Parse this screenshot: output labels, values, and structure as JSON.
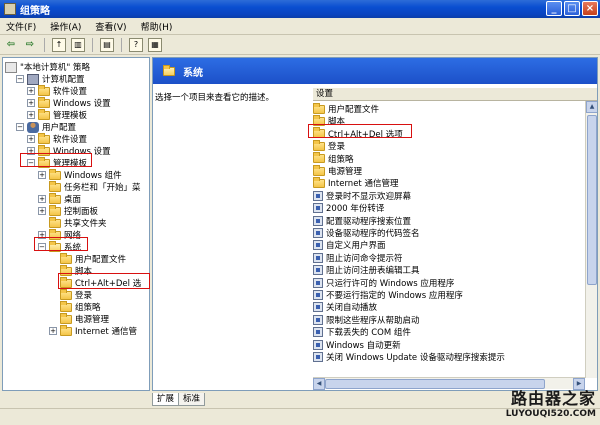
{
  "window": {
    "title": "组策略"
  },
  "menubar": [
    "文件(F)",
    "操作(A)",
    "查看(V)",
    "帮助(H)"
  ],
  "tree": [
    {
      "label": "\"本地计算机\" 策略",
      "indent": 0,
      "exp": "",
      "icon": "policy"
    },
    {
      "label": "计算机配置",
      "indent": 1,
      "exp": "-",
      "icon": "computer"
    },
    {
      "label": "软件设置",
      "indent": 2,
      "exp": "+",
      "icon": "folder"
    },
    {
      "label": "Windows 设置",
      "indent": 2,
      "exp": "+",
      "icon": "folder"
    },
    {
      "label": "管理模板",
      "indent": 2,
      "exp": "+",
      "icon": "folder"
    },
    {
      "label": "用户配置",
      "indent": 1,
      "exp": "-",
      "icon": "user"
    },
    {
      "label": "软件设置",
      "indent": 2,
      "exp": "+",
      "icon": "folder"
    },
    {
      "label": "Windows 设置",
      "indent": 2,
      "exp": "+",
      "icon": "folder"
    },
    {
      "label": "管理模板",
      "indent": 2,
      "exp": "-",
      "icon": "folder"
    },
    {
      "label": "Windows 组件",
      "indent": 3,
      "exp": "+",
      "icon": "folder"
    },
    {
      "label": "任务栏和「开始」菜",
      "indent": 3,
      "exp": "",
      "icon": "folder"
    },
    {
      "label": "桌面",
      "indent": 3,
      "exp": "+",
      "icon": "folder"
    },
    {
      "label": "控制面板",
      "indent": 3,
      "exp": "+",
      "icon": "folder"
    },
    {
      "label": "共享文件夹",
      "indent": 3,
      "exp": "",
      "icon": "folder"
    },
    {
      "label": "网络",
      "indent": 3,
      "exp": "+",
      "icon": "folder"
    },
    {
      "label": "系统",
      "indent": 3,
      "exp": "-",
      "icon": "folder-open"
    },
    {
      "label": "用户配置文件",
      "indent": 4,
      "exp": "",
      "icon": "folder"
    },
    {
      "label": "脚本",
      "indent": 4,
      "exp": "",
      "icon": "folder"
    },
    {
      "label": "Ctrl+Alt+Del 选",
      "indent": 4,
      "exp": "",
      "icon": "folder"
    },
    {
      "label": "登录",
      "indent": 4,
      "exp": "",
      "icon": "folder"
    },
    {
      "label": "组策略",
      "indent": 4,
      "exp": "",
      "icon": "folder"
    },
    {
      "label": "电源管理",
      "indent": 4,
      "exp": "",
      "icon": "folder"
    },
    {
      "label": "Internet 通信管",
      "indent": 4,
      "exp": "+",
      "icon": "folder"
    }
  ],
  "right": {
    "header_title": "系统",
    "description": "选择一个项目来查看它的描述。",
    "column_header": "设置",
    "items": [
      {
        "label": "用户配置文件",
        "icon": "folder"
      },
      {
        "label": "脚本",
        "icon": "folder"
      },
      {
        "label": "Ctrl+Alt+Del 选项",
        "icon": "folder"
      },
      {
        "label": "登录",
        "icon": "folder"
      },
      {
        "label": "组策略",
        "icon": "folder"
      },
      {
        "label": "电源管理",
        "icon": "folder"
      },
      {
        "label": "Internet 通信管理",
        "icon": "folder"
      },
      {
        "label": "登录时不显示欢迎屏幕",
        "icon": "setting"
      },
      {
        "label": "2000 年份转译",
        "icon": "setting"
      },
      {
        "label": "配置驱动程序搜索位置",
        "icon": "setting"
      },
      {
        "label": "设备驱动程序的代码签名",
        "icon": "setting"
      },
      {
        "label": "自定义用户界面",
        "icon": "setting"
      },
      {
        "label": "阻止访问命令提示符",
        "icon": "setting"
      },
      {
        "label": "阻止访问注册表编辑工具",
        "icon": "setting"
      },
      {
        "label": "只运行许可的 Windows 应用程序",
        "icon": "setting"
      },
      {
        "label": "不要运行指定的 Windows 应用程序",
        "icon": "setting"
      },
      {
        "label": "关闭自动播放",
        "icon": "setting"
      },
      {
        "label": "限制这些程序从帮助启动",
        "icon": "setting"
      },
      {
        "label": "下载丢失的 COM 组件",
        "icon": "setting"
      },
      {
        "label": "Windows 自动更新",
        "icon": "setting"
      },
      {
        "label": "关闭 Windows Update 设备驱动程序搜索提示",
        "icon": "setting"
      }
    ]
  },
  "tabs": [
    "扩展",
    "标准"
  ],
  "watermark": {
    "main": "路由器之家",
    "sub": "LUYOUQI520.COM"
  }
}
